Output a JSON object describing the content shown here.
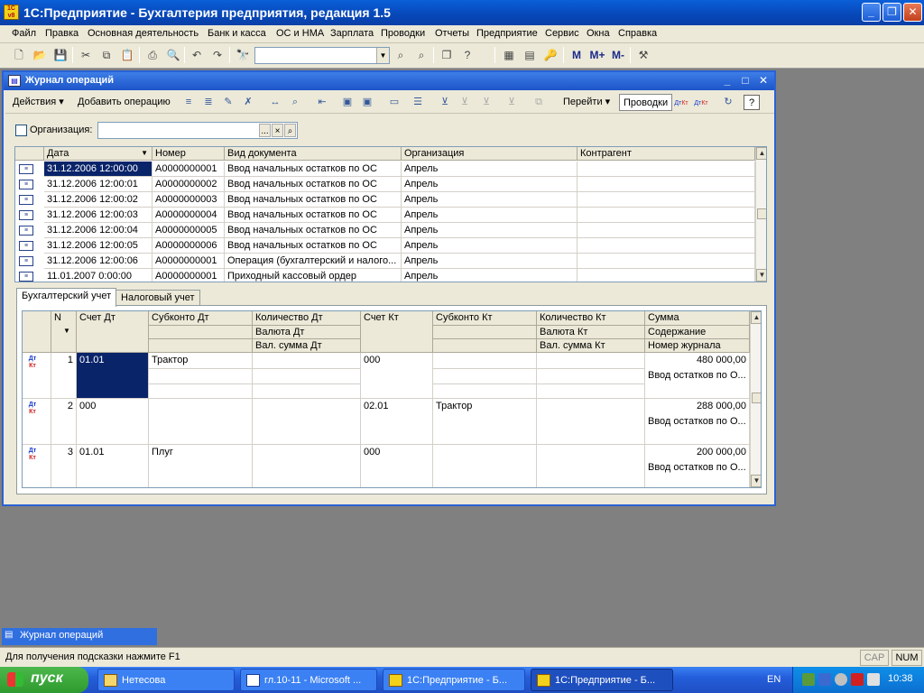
{
  "app": {
    "title": "1С:Предприятие - Бухгалтерия предприятия, редакция 1.5",
    "icon_label": "1С\nv8"
  },
  "menu": [
    "Файл",
    "Правка",
    "Основная деятельность",
    "Банк и касса",
    "ОС и НМА",
    "Зарплата",
    "Проводки",
    "Отчеты",
    "Предприятие",
    "Сервис",
    "Окна",
    "Справка"
  ],
  "window": {
    "title": "Журнал операций"
  },
  "window_toolbar": {
    "actions": "Действия",
    "add_operation": "Добавить операцию",
    "goto": "Перейти",
    "postings": "Проводки",
    "help": "?"
  },
  "filter": {
    "org_label": "Организация:",
    "org_value": "",
    "btn_select": "...",
    "btn_clear": "×"
  },
  "journal": {
    "columns": [
      "Дата",
      "Номер",
      "Вид документа",
      "Организация",
      "Контрагент"
    ],
    "rows": [
      {
        "date": "31.12.2006 12:00:00",
        "number": "А0000000001",
        "doctype": "Ввод начальных остатков по ОС",
        "org": "Апрель",
        "counterparty": ""
      },
      {
        "date": "31.12.2006 12:00:01",
        "number": "А0000000002",
        "doctype": "Ввод начальных остатков по ОС",
        "org": "Апрель",
        "counterparty": ""
      },
      {
        "date": "31.12.2006 12:00:02",
        "number": "А0000000003",
        "doctype": "Ввод начальных остатков по ОС",
        "org": "Апрель",
        "counterparty": ""
      },
      {
        "date": "31.12.2006 12:00:03",
        "number": "А0000000004",
        "doctype": "Ввод начальных остатков по ОС",
        "org": "Апрель",
        "counterparty": ""
      },
      {
        "date": "31.12.2006 12:00:04",
        "number": "А0000000005",
        "doctype": "Ввод начальных остатков по ОС",
        "org": "Апрель",
        "counterparty": ""
      },
      {
        "date": "31.12.2006 12:00:05",
        "number": "А0000000006",
        "doctype": "Ввод начальных остатков по ОС",
        "org": "Апрель",
        "counterparty": ""
      },
      {
        "date": "31.12.2006 12:00:06",
        "number": "А0000000001",
        "doctype": "Операция (бухгалтерский и налого...",
        "org": "Апрель",
        "counterparty": ""
      },
      {
        "date": "11.01.2007 0:00:00",
        "number": "А0000000001",
        "doctype": "Приходный кассовый ордер",
        "org": "Апрель",
        "counterparty": ""
      }
    ]
  },
  "tabs": [
    "Бухгалтерский учет",
    "Налоговый учет"
  ],
  "postings": {
    "headers": {
      "n": "N",
      "acc_dt": "Счет Дт",
      "sub_dt": "Субконто Дт",
      "qty_dt": "Количество Дт",
      "cur_dt": "Валюта Дт",
      "valsum_dt": "Вал. сумма Дт",
      "acc_kt": "Счет Кт",
      "sub_kt": "Субконто Кт",
      "qty_kt": "Количество Кт",
      "cur_kt": "Валюта Кт",
      "valsum_kt": "Вал. сумма Кт",
      "sum": "Сумма",
      "content": "Содержание",
      "journal_no": "Номер журнала"
    },
    "rows": [
      {
        "n": "1",
        "acc_dt": "01.01",
        "sub_dt": "Трактор",
        "acc_kt": "000",
        "sub_kt": "",
        "sum": "480 000,00",
        "content": "Ввод остатков по О..."
      },
      {
        "n": "2",
        "acc_dt": "000",
        "sub_dt": "",
        "acc_kt": "02.01",
        "sub_kt": "Трактор",
        "sum": "288 000,00",
        "content": "Ввод остатков по О..."
      },
      {
        "n": "3",
        "acc_dt": "01.01",
        "sub_dt": "Плуг",
        "acc_kt": "000",
        "sub_kt": "",
        "sum": "200 000,00",
        "content": "Ввод остатков по О..."
      }
    ],
    "icon_dt": "Дт",
    "icon_kt": "Кт"
  },
  "mdi_tab": "Журнал операций",
  "status": {
    "hint": "Для получения подсказки нажмите F1",
    "cap": "CAP",
    "num": "NUM"
  },
  "taskbar": {
    "start": "пуск",
    "tasks": [
      "Нетесова",
      "гл.10-11 - Microsoft ...",
      "1С:Предприятие - Б...",
      "1С:Предприятие - Б..."
    ],
    "lang": "EN",
    "clock": "10:38"
  }
}
